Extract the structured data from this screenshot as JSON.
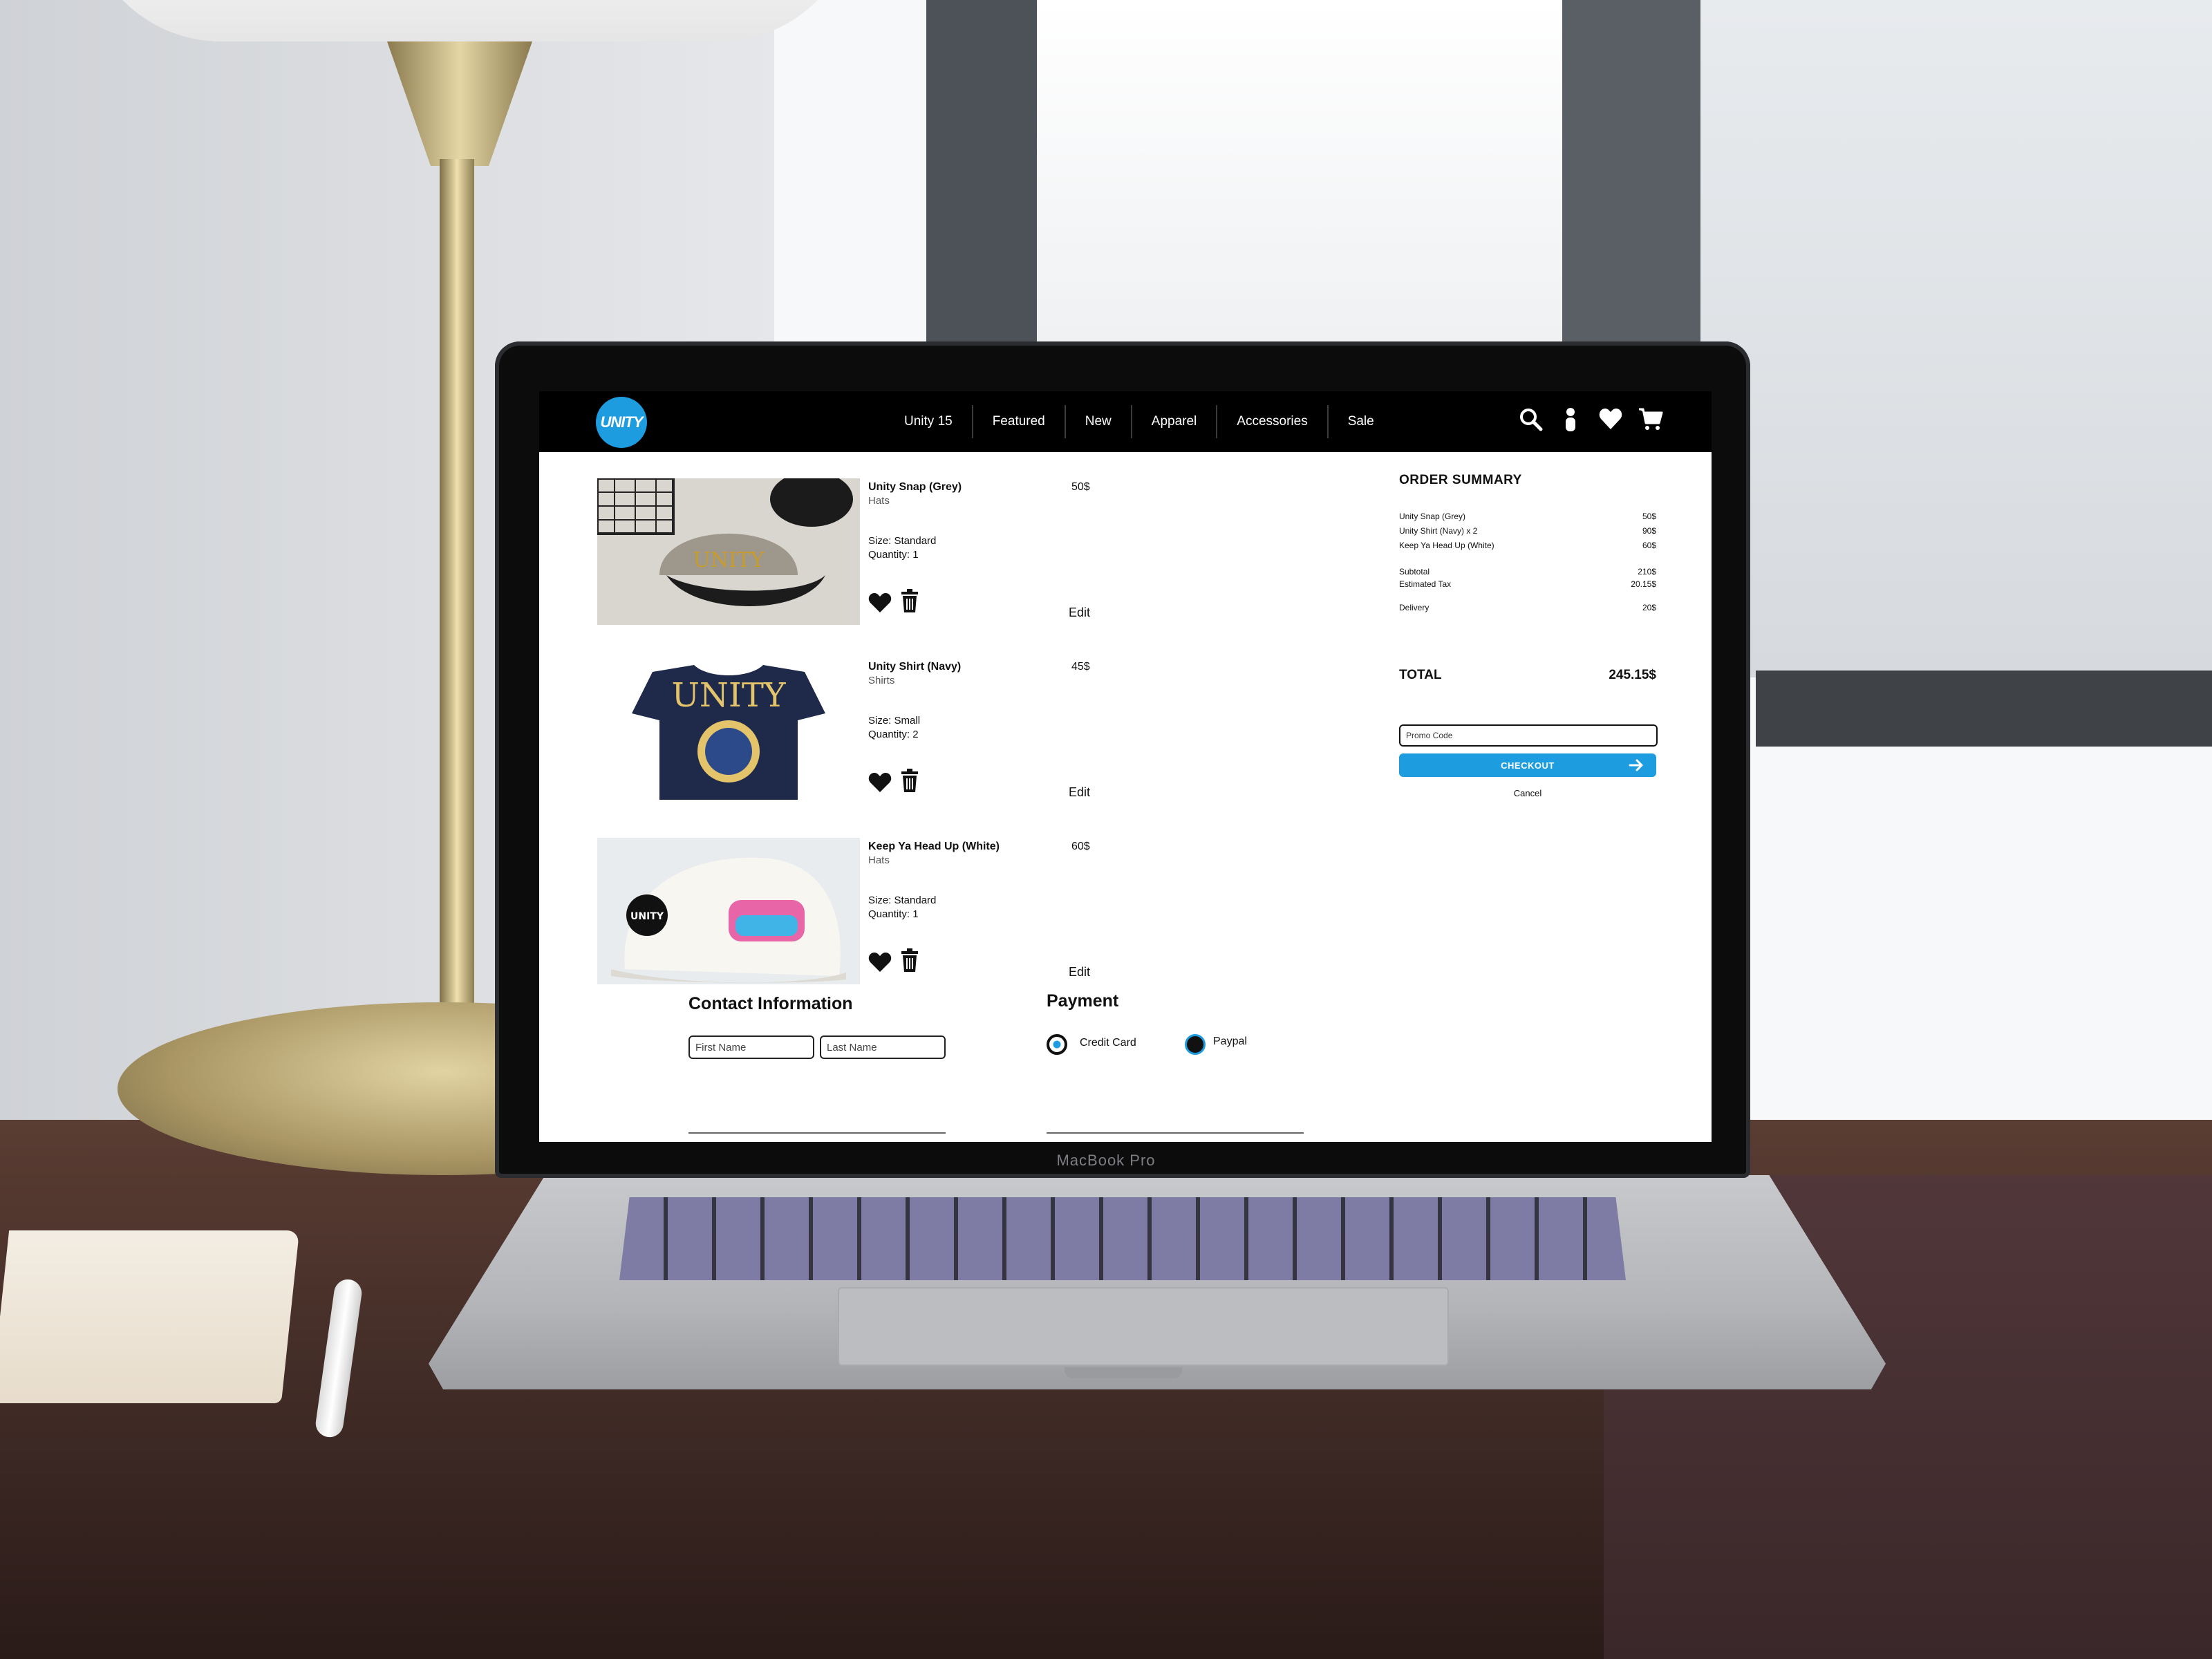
{
  "device_label": "MacBook Pro",
  "site": {
    "logo_text": "UNITY",
    "accent_color": "#1d9ce0",
    "nav": [
      {
        "label": "Unity 15"
      },
      {
        "label": "Featured"
      },
      {
        "label": "New"
      },
      {
        "label": "Apparel"
      },
      {
        "label": "Accessories"
      },
      {
        "label": "Sale"
      }
    ],
    "icons": [
      "search-icon",
      "account-icon",
      "heart-icon",
      "cart-icon"
    ]
  },
  "cart": {
    "items": [
      {
        "name": "Unity Snap (Grey)",
        "category": "Hats",
        "size": "Size: Standard",
        "quantity": "Quantity: 1",
        "price": "50$",
        "edit": "Edit",
        "print": "UNITY"
      },
      {
        "name": "Unity Shirt (Navy)",
        "category": "Shirts",
        "size": "Size: Small",
        "quantity": "Quantity: 2",
        "price": "45$",
        "edit": "Edit",
        "print": "UNITY"
      },
      {
        "name": "Keep Ya Head Up (White)",
        "category": "Hats",
        "size": "Size: Standard",
        "quantity": "Quantity: 1",
        "price": "60$",
        "edit": "Edit",
        "print": "UNITY"
      }
    ]
  },
  "summary": {
    "title": "ORDER SUMMARY",
    "lines": [
      {
        "label": "Unity Snap (Grey)",
        "value": "50$"
      },
      {
        "label": "Unity Shirt (Navy) x 2",
        "value": "90$"
      },
      {
        "label": "Keep Ya Head Up (White)",
        "value": "60$"
      },
      {
        "label": "Subtotal",
        "value": "210$"
      },
      {
        "label": "Estimated Tax",
        "value": "20.15$"
      },
      {
        "label": "Delivery",
        "value": "20$"
      }
    ],
    "total_label": "TOTAL",
    "total_value": "245.15$",
    "promo_placeholder": "Promo Code",
    "checkout_label": "CHECKOUT",
    "cancel_label": "Cancel"
  },
  "contact": {
    "title": "Contact Information",
    "first_name_placeholder": "First Name",
    "last_name_placeholder": "Last Name"
  },
  "payment": {
    "title": "Payment",
    "options": [
      {
        "label": "Credit Card",
        "selected": true
      },
      {
        "label": "Paypal",
        "selected": false
      }
    ]
  }
}
